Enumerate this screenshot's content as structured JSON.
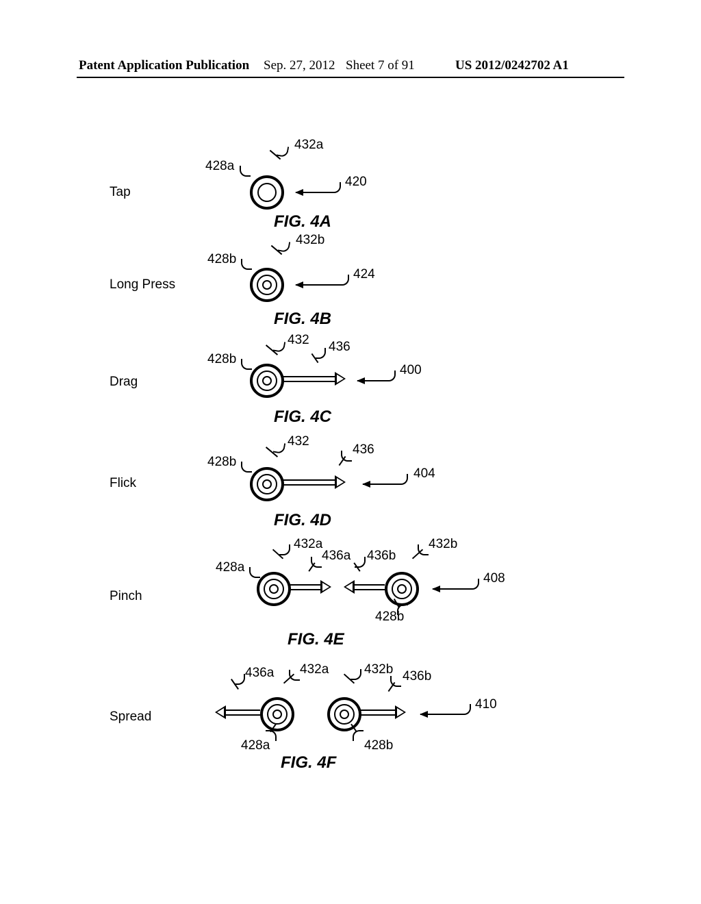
{
  "header": {
    "publication_title": "Patent Application Publication",
    "date": "Sep. 27, 2012",
    "sheet": "Sheet 7 of 91",
    "docnum": "US 2012/0242702 A1"
  },
  "gestures": {
    "tap": {
      "label": "Tap",
      "fig": "FIG. 4A",
      "refs": {
        "r428a": "428a",
        "r432a": "432a",
        "r420": "420"
      }
    },
    "longpress": {
      "label": "Long Press",
      "fig": "FIG. 4B",
      "refs": {
        "r428b": "428b",
        "r432b": "432b",
        "r424": "424"
      }
    },
    "drag": {
      "label": "Drag",
      "fig": "FIG. 4C",
      "refs": {
        "r428b": "428b",
        "r432": "432",
        "r436": "436",
        "r400": "400"
      }
    },
    "flick": {
      "label": "Flick",
      "fig": "FIG. 4D",
      "refs": {
        "r428b": "428b",
        "r432": "432",
        "r436": "436",
        "r404": "404"
      }
    },
    "pinch": {
      "label": "Pinch",
      "fig": "FIG. 4E",
      "refs": {
        "r428a": "428a",
        "r432a": "432a",
        "r436a": "436a",
        "r428b": "428b",
        "r432b": "432b",
        "r436b": "436b",
        "r408": "408"
      }
    },
    "spread": {
      "label": "Spread",
      "fig": "FIG. 4F",
      "refs": {
        "r428a": "428a",
        "r432a": "432a",
        "r436a": "436a",
        "r428b": "428b",
        "r432b": "432b",
        "r436b": "436b",
        "r410": "410"
      }
    }
  }
}
